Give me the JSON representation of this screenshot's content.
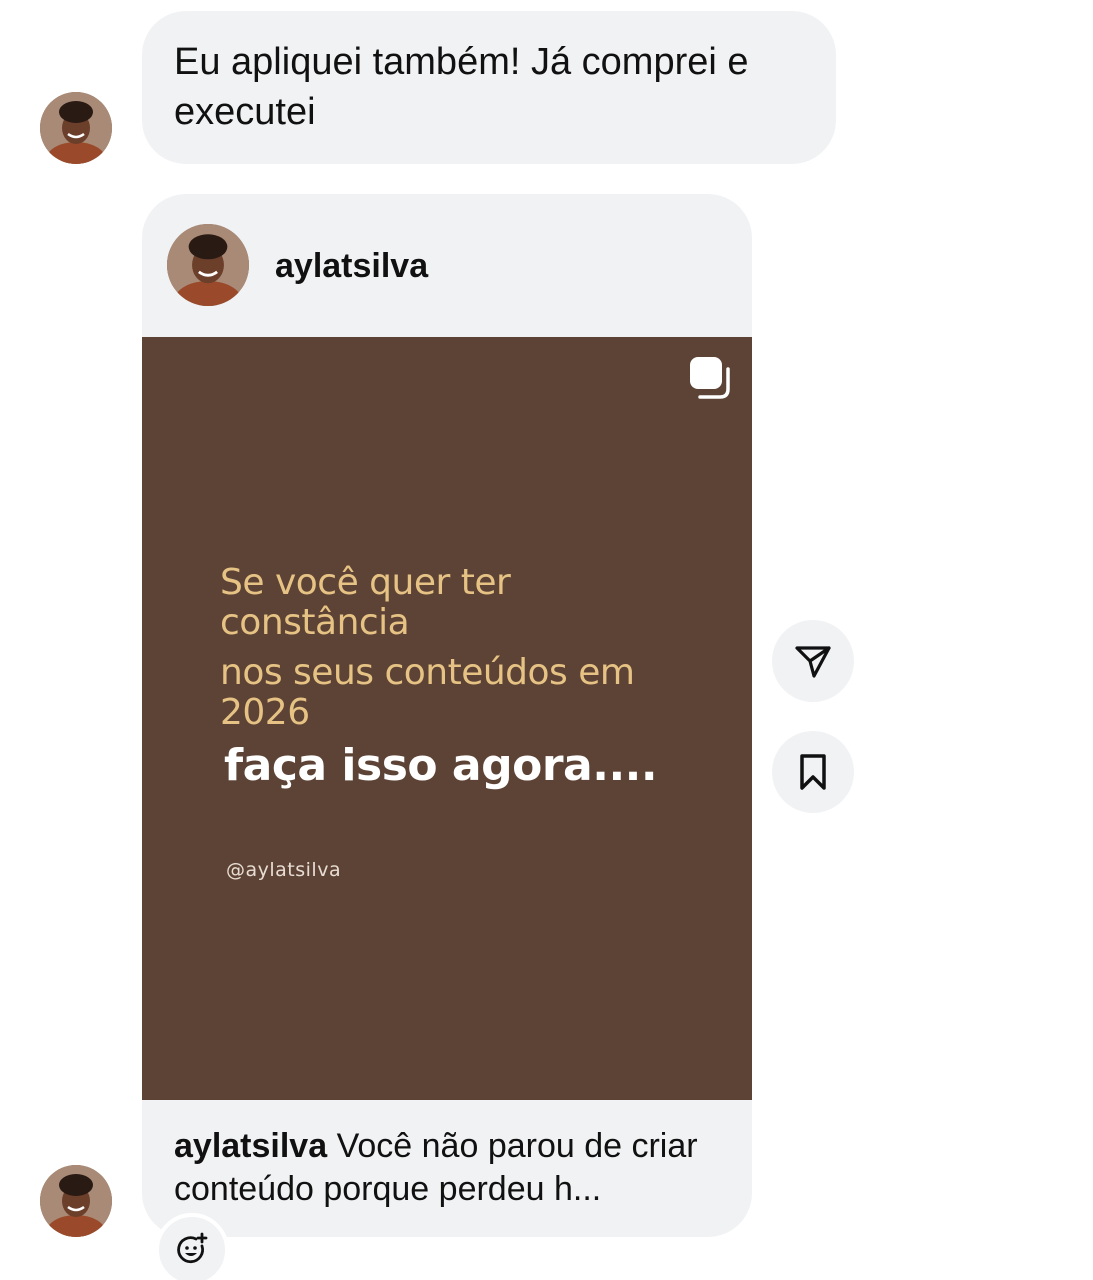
{
  "messages": [
    {
      "type": "text",
      "text": "Eu apliquei também! Já comprei e executei"
    }
  ],
  "shared_post": {
    "username": "aylatsilva",
    "image": {
      "background_color": "#5d4335",
      "line1": "Se você quer ter constância",
      "line2": "nos seus conteúdos em 2026",
      "line3": "faça isso agora....",
      "handle": "@aylatsilva"
    },
    "caption_user": "aylatsilva",
    "caption_text": "Você não parou de criar conteúdo porque perdeu h..."
  },
  "actions": {
    "share_icon": "send-icon",
    "save_icon": "bookmark-icon",
    "react_icon": "emoji-add-icon"
  }
}
